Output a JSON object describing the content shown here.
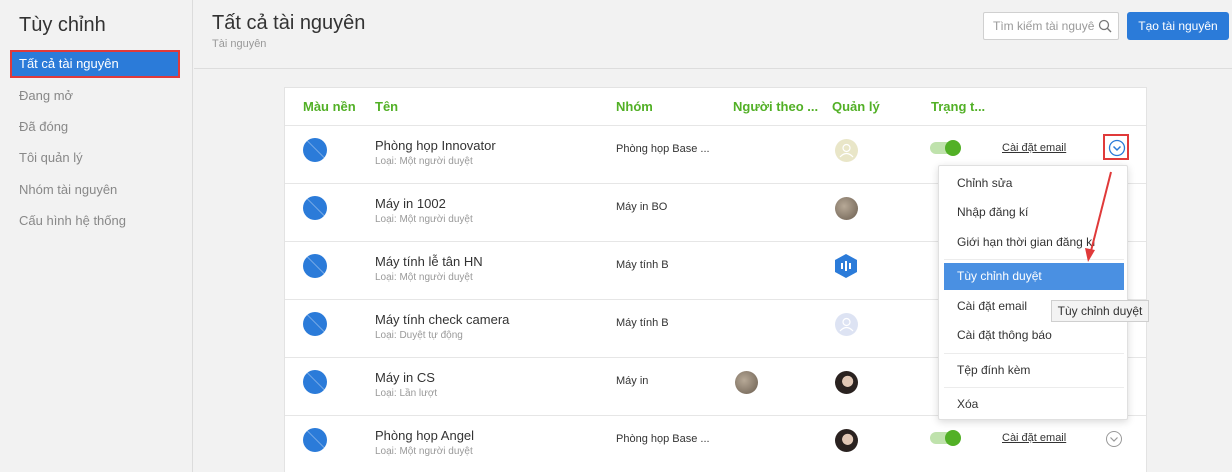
{
  "sidebar": {
    "title": "Tùy chỉnh",
    "items": [
      {
        "label": "Tất cả tài nguyên"
      },
      {
        "label": "Đang mở"
      },
      {
        "label": "Đã đóng"
      },
      {
        "label": "Tôi quản lý"
      },
      {
        "label": "Nhóm tài nguyên"
      },
      {
        "label": "Cấu hình hệ thống"
      }
    ]
  },
  "header": {
    "title": "Tất cả tài nguyên",
    "breadcrumb": "Tài nguyên",
    "search_placeholder": "Tìm kiếm tài nguyên",
    "create_label": "Tạo tài nguyên"
  },
  "table": {
    "columns": [
      "Màu nền",
      "Tên",
      "Nhóm",
      "Người theo ...",
      "Quản lý",
      "Trạng t..."
    ],
    "rows": [
      {
        "name": "Phòng họp Innovator",
        "type": "Loại: Một người duyệt",
        "group": "Phòng họp Base ...",
        "email_link": "Cài đặt email",
        "color": "#2b7bd9"
      },
      {
        "name": "Máy in 1002",
        "type": "Loại: Một người duyệt",
        "group": "Máy in BO",
        "color": "#2b7bd9"
      },
      {
        "name": "Máy tính lễ tân HN",
        "type": "Loại: Một người duyệt",
        "group": "Máy tính B",
        "color": "#2b7bd9"
      },
      {
        "name": "Máy tính check camera",
        "type": "Loại: Duyệt tự động",
        "group": "Máy tính B",
        "color": "#2b7bd9"
      },
      {
        "name": "Máy in CS",
        "type": "Loại: Lần lượt",
        "group": "Máy in",
        "color": "#2b7bd9"
      },
      {
        "name": "Phòng họp Angel",
        "type": "Loại: Một người duyệt",
        "group": "Phòng họp Base ...",
        "email_link": "Cài đặt email",
        "color": "#2b7bd9"
      }
    ]
  },
  "menu": {
    "items": [
      {
        "label": "Chỉnh sửa"
      },
      {
        "label": "Nhập đăng kí"
      },
      {
        "label": "Giới hạn thời gian đăng kí"
      },
      {
        "label": "Tùy chỉnh duyệt"
      },
      {
        "label": "Cài đặt email"
      },
      {
        "label": "Cài đặt thông báo"
      },
      {
        "label": "Tệp đính kèm"
      },
      {
        "label": "Xóa"
      }
    ],
    "tooltip": "Tùy chỉnh duyệt"
  },
  "colors": {
    "accent": "#2b7bd9",
    "header_green": "#52b026",
    "highlight_red": "#e03a3a"
  }
}
